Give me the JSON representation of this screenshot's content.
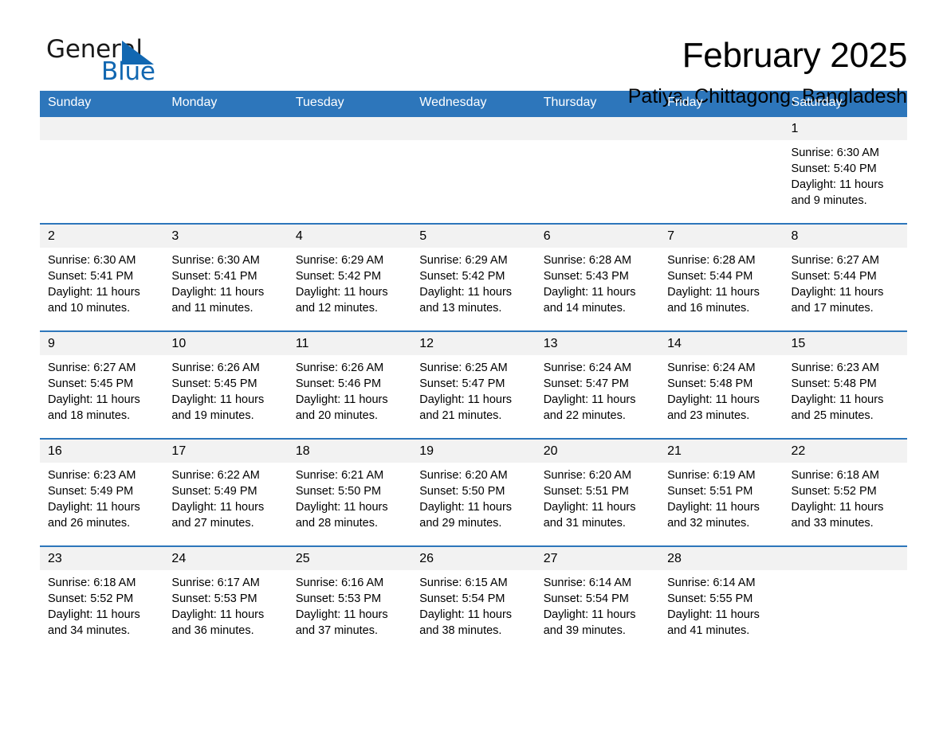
{
  "brand": {
    "name_part1": "General",
    "name_part2": "Blue",
    "flag_color": "#1167b1"
  },
  "header": {
    "month_title": "February 2025",
    "location": "Patiya, Chittagong, Bangladesh"
  },
  "theme": {
    "header_bg": "#2d76bb",
    "daynum_bg": "#f2f2f2",
    "text": "#000000"
  },
  "calendar": {
    "weekday_headers": [
      "Sunday",
      "Monday",
      "Tuesday",
      "Wednesday",
      "Thursday",
      "Friday",
      "Saturday"
    ],
    "weeks": [
      [
        {
          "day": "",
          "info": ""
        },
        {
          "day": "",
          "info": ""
        },
        {
          "day": "",
          "info": ""
        },
        {
          "day": "",
          "info": ""
        },
        {
          "day": "",
          "info": ""
        },
        {
          "day": "",
          "info": ""
        },
        {
          "day": "1",
          "info": "Sunrise: 6:30 AM\nSunset: 5:40 PM\nDaylight: 11 hours\nand 9 minutes."
        }
      ],
      [
        {
          "day": "2",
          "info": "Sunrise: 6:30 AM\nSunset: 5:41 PM\nDaylight: 11 hours\nand 10 minutes."
        },
        {
          "day": "3",
          "info": "Sunrise: 6:30 AM\nSunset: 5:41 PM\nDaylight: 11 hours\nand 11 minutes."
        },
        {
          "day": "4",
          "info": "Sunrise: 6:29 AM\nSunset: 5:42 PM\nDaylight: 11 hours\nand 12 minutes."
        },
        {
          "day": "5",
          "info": "Sunrise: 6:29 AM\nSunset: 5:42 PM\nDaylight: 11 hours\nand 13 minutes."
        },
        {
          "day": "6",
          "info": "Sunrise: 6:28 AM\nSunset: 5:43 PM\nDaylight: 11 hours\nand 14 minutes."
        },
        {
          "day": "7",
          "info": "Sunrise: 6:28 AM\nSunset: 5:44 PM\nDaylight: 11 hours\nand 16 minutes."
        },
        {
          "day": "8",
          "info": "Sunrise: 6:27 AM\nSunset: 5:44 PM\nDaylight: 11 hours\nand 17 minutes."
        }
      ],
      [
        {
          "day": "9",
          "info": "Sunrise: 6:27 AM\nSunset: 5:45 PM\nDaylight: 11 hours\nand 18 minutes."
        },
        {
          "day": "10",
          "info": "Sunrise: 6:26 AM\nSunset: 5:45 PM\nDaylight: 11 hours\nand 19 minutes."
        },
        {
          "day": "11",
          "info": "Sunrise: 6:26 AM\nSunset: 5:46 PM\nDaylight: 11 hours\nand 20 minutes."
        },
        {
          "day": "12",
          "info": "Sunrise: 6:25 AM\nSunset: 5:47 PM\nDaylight: 11 hours\nand 21 minutes."
        },
        {
          "day": "13",
          "info": "Sunrise: 6:24 AM\nSunset: 5:47 PM\nDaylight: 11 hours\nand 22 minutes."
        },
        {
          "day": "14",
          "info": "Sunrise: 6:24 AM\nSunset: 5:48 PM\nDaylight: 11 hours\nand 23 minutes."
        },
        {
          "day": "15",
          "info": "Sunrise: 6:23 AM\nSunset: 5:48 PM\nDaylight: 11 hours\nand 25 minutes."
        }
      ],
      [
        {
          "day": "16",
          "info": "Sunrise: 6:23 AM\nSunset: 5:49 PM\nDaylight: 11 hours\nand 26 minutes."
        },
        {
          "day": "17",
          "info": "Sunrise: 6:22 AM\nSunset: 5:49 PM\nDaylight: 11 hours\nand 27 minutes."
        },
        {
          "day": "18",
          "info": "Sunrise: 6:21 AM\nSunset: 5:50 PM\nDaylight: 11 hours\nand 28 minutes."
        },
        {
          "day": "19",
          "info": "Sunrise: 6:20 AM\nSunset: 5:50 PM\nDaylight: 11 hours\nand 29 minutes."
        },
        {
          "day": "20",
          "info": "Sunrise: 6:20 AM\nSunset: 5:51 PM\nDaylight: 11 hours\nand 31 minutes."
        },
        {
          "day": "21",
          "info": "Sunrise: 6:19 AM\nSunset: 5:51 PM\nDaylight: 11 hours\nand 32 minutes."
        },
        {
          "day": "22",
          "info": "Sunrise: 6:18 AM\nSunset: 5:52 PM\nDaylight: 11 hours\nand 33 minutes."
        }
      ],
      [
        {
          "day": "23",
          "info": "Sunrise: 6:18 AM\nSunset: 5:52 PM\nDaylight: 11 hours\nand 34 minutes."
        },
        {
          "day": "24",
          "info": "Sunrise: 6:17 AM\nSunset: 5:53 PM\nDaylight: 11 hours\nand 36 minutes."
        },
        {
          "day": "25",
          "info": "Sunrise: 6:16 AM\nSunset: 5:53 PM\nDaylight: 11 hours\nand 37 minutes."
        },
        {
          "day": "26",
          "info": "Sunrise: 6:15 AM\nSunset: 5:54 PM\nDaylight: 11 hours\nand 38 minutes."
        },
        {
          "day": "27",
          "info": "Sunrise: 6:14 AM\nSunset: 5:54 PM\nDaylight: 11 hours\nand 39 minutes."
        },
        {
          "day": "28",
          "info": "Sunrise: 6:14 AM\nSunset: 5:55 PM\nDaylight: 11 hours\nand 41 minutes."
        },
        {
          "day": "",
          "info": ""
        }
      ]
    ]
  }
}
